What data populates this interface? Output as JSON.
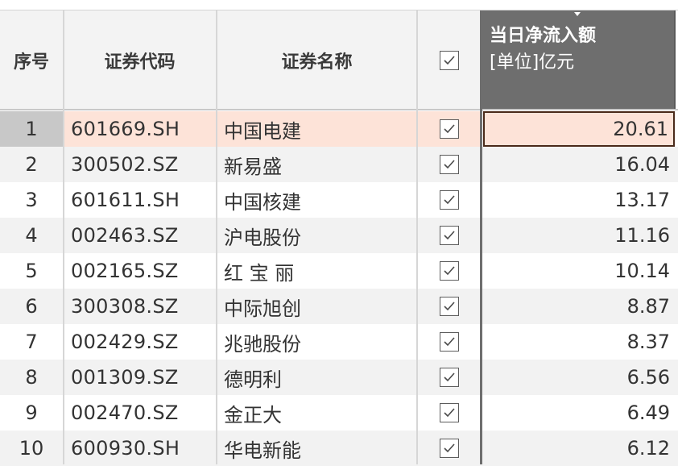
{
  "header": {
    "index": "序号",
    "code": "证券代码",
    "name": "证券名称",
    "value_title": "当日净流入额",
    "value_unit": "[单位]亿元"
  },
  "rows": [
    {
      "index": "1",
      "code": "601669.SH",
      "name": "中国电建",
      "checked": true,
      "value": "20.61"
    },
    {
      "index": "2",
      "code": "300502.SZ",
      "name": "新易盛",
      "checked": true,
      "value": "16.04"
    },
    {
      "index": "3",
      "code": "601611.SH",
      "name": "中国核建",
      "checked": true,
      "value": "13.17"
    },
    {
      "index": "4",
      "code": "002463.SZ",
      "name": "沪电股份",
      "checked": true,
      "value": "11.16"
    },
    {
      "index": "5",
      "code": "002165.SZ",
      "name": "红 宝 丽",
      "checked": true,
      "value": "10.14"
    },
    {
      "index": "6",
      "code": "300308.SZ",
      "name": "中际旭创",
      "checked": true,
      "value": "8.87"
    },
    {
      "index": "7",
      "code": "002429.SZ",
      "name": "兆驰股份",
      "checked": true,
      "value": "8.37"
    },
    {
      "index": "8",
      "code": "001309.SZ",
      "name": "德明利",
      "checked": true,
      "value": "6.56"
    },
    {
      "index": "9",
      "code": "002470.SZ",
      "name": "金正大",
      "checked": true,
      "value": "6.49"
    },
    {
      "index": "10",
      "code": "600930.SH",
      "name": "华电新能",
      "checked": true,
      "value": "6.12"
    }
  ],
  "colors": {
    "selected_row": "#fde3d8",
    "selected_header": "#6e6e6e",
    "alt_row": "#f2f2f2",
    "header_bg": "#f3f3f3"
  }
}
